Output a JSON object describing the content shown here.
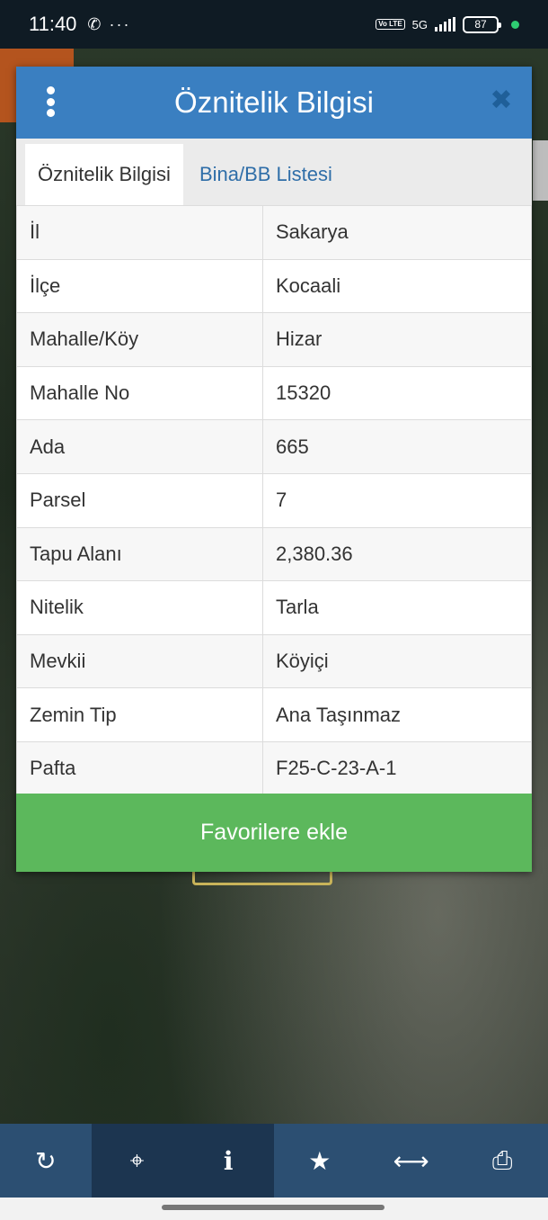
{
  "status_bar": {
    "time": "11:40",
    "left_icons": "✆ ···",
    "network": "5G",
    "volte": "Vo LTE",
    "battery": "87"
  },
  "dialog": {
    "title": "Öznitelik Bilgisi",
    "tabs": [
      {
        "label": "Öznitelik Bilgisi",
        "active": true
      },
      {
        "label": "Bina/BB Listesi",
        "active": false
      }
    ],
    "rows": [
      {
        "key": "İl",
        "value": "Sakarya"
      },
      {
        "key": "İlçe",
        "value": "Kocaali"
      },
      {
        "key": "Mahalle/Köy",
        "value": "Hizar"
      },
      {
        "key": "Mahalle No",
        "value": "15320"
      },
      {
        "key": "Ada",
        "value": "665"
      },
      {
        "key": "Parsel",
        "value": "7"
      },
      {
        "key": "Tapu Alanı",
        "value": "2,380.36"
      },
      {
        "key": "Nitelik",
        "value": "Tarla"
      },
      {
        "key": "Mevkii",
        "value": "Köyiçi"
      },
      {
        "key": "Zemin Tip",
        "value": "Ana Taşınmaz"
      },
      {
        "key": "Pafta",
        "value": "F25-C-23-A-1"
      }
    ],
    "favorite_button": "Favorilere ekle"
  },
  "toolbar": {
    "items": [
      {
        "icon": "refresh-icon",
        "glyph": "↻"
      },
      {
        "icon": "locate-icon",
        "glyph": "⌖"
      },
      {
        "icon": "info-icon",
        "glyph": "i"
      },
      {
        "icon": "star-icon",
        "glyph": "★"
      },
      {
        "icon": "measure-icon",
        "glyph": "⟷"
      },
      {
        "icon": "print-icon",
        "glyph": "⎙"
      }
    ]
  },
  "colors": {
    "header": "#3a7fc1",
    "favorite": "#5cb85c",
    "toolbar": "#2c4f72",
    "tab_link": "#2f6ea8"
  }
}
